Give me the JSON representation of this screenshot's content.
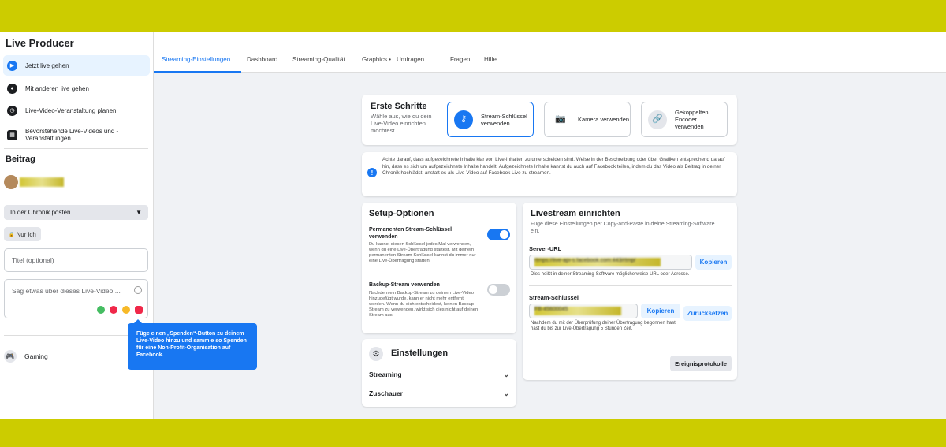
{
  "sidebar": {
    "title": "Live Producer",
    "items": [
      {
        "label": "Jetzt live gehen"
      },
      {
        "label": "Mit anderen live gehen"
      },
      {
        "label": "Live-Video-Veranstaltung planen"
      },
      {
        "label": "Bevorstehende Live-Videos und -Veranstaltungen"
      }
    ],
    "section_title": "Beitrag",
    "post_target": "In der Chronik posten",
    "audience": "Nur ich",
    "title_placeholder": "Titel (optional)",
    "description_placeholder": "Sag etwas über dieses Live-Video ...",
    "tooltip": "Füge einen „Spenden“-Button zu deinem Live-Video hinzu und sammle so Spenden für eine Non-Profit-Organisation auf Facebook.",
    "gaming": "Gaming"
  },
  "tabs": [
    "Streaming-Einstellungen",
    "Dashboard",
    "Streaming-Qualität",
    "Graphics •",
    "Umfragen",
    "Fragen",
    "Hilfe"
  ],
  "first_steps": {
    "title": "Erste Schritte",
    "subtitle": "Wähle aus, wie du dein Live-Video einrichten möchtest.",
    "options": [
      "Stream-Schlüssel verwenden",
      "Kamera verwenden",
      "Gekoppelten Encoder verwenden"
    ]
  },
  "notice": "Achte darauf, dass aufgezeichnete Inhalte klar von Live-Inhalten zu unterscheiden sind. Weise in der Beschreibung oder über Grafiken entsprechend darauf hin, dass es sich um aufgezeichnete Inhalte handelt. Aufgezeichnete Inhalte kannst du auch auf Facebook teilen, indem du das Video als Beitrag in deiner Chronik hochlädst, anstatt es als Live-Video auf Facebook Live zu streamen.",
  "setup": {
    "title": "Setup-Optionen",
    "persistent_title": "Permanenten Stream-Schlüssel verwenden",
    "persistent_desc": "Du kannst diesen Schlüssel jedes Mal verwenden, wenn du eine Live-Übertragung startest. Mit deinem permanenten Stream-Schlüssel kannst du immer nur eine Live-Übertragung starten.",
    "backup_title": "Backup-Stream verwenden",
    "backup_desc": "Nachdem ein Backup-Stream zu deinem Live-Video hinzugefügt wurde, kann er nicht mehr entfernt werden. Wenn du dich entscheidest, keinen Backup-Stream zu verwenden, wirkt sich dies nicht auf deinen Stream aus."
  },
  "settings": {
    "title": "Einstellungen",
    "rows": [
      "Streaming",
      "Zuschauer"
    ]
  },
  "livestream": {
    "title": "Livestream einrichten",
    "subtitle": "Füge diese Einstellungen per Copy-and-Paste in deine Streaming-Software ein.",
    "server_label": "Server-URL",
    "server_value": "rtmps://live-api-s.facebook.com:443/rtmp/",
    "server_hint": "Dies heißt in deiner Streaming-Software möglicherweise URL oder Adresse.",
    "copy": "Kopieren",
    "key_label": "Stream-Schlüssel",
    "key_value": "FB-45600045",
    "reset": "Zurücksetzen",
    "key_hint": "Nachdem du mit der Überprüfung deiner Übertragung begonnen hast, hast du bis zur Live-Übertragung 5 Stunden Zeit.",
    "events": "Ereignisprotokolle"
  }
}
